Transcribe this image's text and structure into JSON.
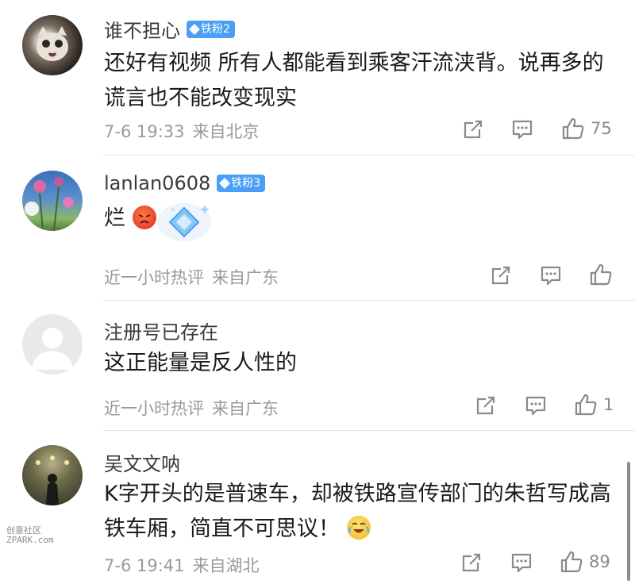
{
  "comments": [
    {
      "name": "谁不担心",
      "badge": "铁粉2",
      "text": "还好有视频 所有人都能看到乘客汗流浃背。说再多的谎言也不能改变现实",
      "time": "7-6 19:33",
      "location": "来自北京",
      "likes": "75"
    },
    {
      "name": "lanlan0608",
      "badge": "铁粉3",
      "text": "烂",
      "time": "近一小时热评",
      "location": "来自广东",
      "likes": ""
    },
    {
      "name": "注册号已存在",
      "badge": "",
      "text": "这正能量是反人性的",
      "time": "近一小时热评",
      "location": "来自广东",
      "likes": "1"
    },
    {
      "name": "吴文文呐",
      "badge": "",
      "text": "K字开头的是普速车，却被铁路宣传部门的朱哲写成高铁车厢，简直不可思议！",
      "time": "7-6 19:41",
      "location": "来自湖北",
      "likes": "89"
    }
  ],
  "icons": {
    "share": "share-icon",
    "comment": "comment-icon",
    "like": "thumbs-up-icon",
    "angry_emoji": "angry-face-emoji",
    "laugh_emoji": "laughing-crying-emoji",
    "gem_sticker": "diamond-sticker"
  },
  "watermark": {
    "line1": "创意社区",
    "line2": "ZPARK.com"
  },
  "colors": {
    "badge": "#4a9ff5",
    "meta": "#9a9a9a",
    "icon": "#8a8a8a"
  }
}
